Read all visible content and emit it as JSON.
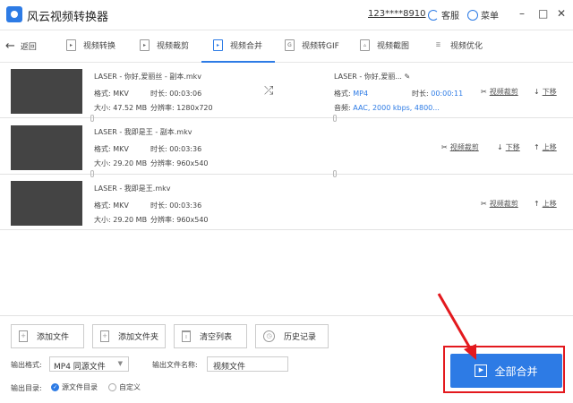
{
  "app": {
    "title": "风云视频转换器",
    "account": "123****8910",
    "service": "客服",
    "menu": "菜单"
  },
  "nav": {
    "back": "返回",
    "tabs": [
      "视频转换",
      "视频裁剪",
      "视频合并",
      "视频转GIF",
      "视频截图",
      "视频优化"
    ],
    "active": 2
  },
  "files": [
    {
      "name": "LASER - 你好,爱丽丝 - 副本.mkv",
      "format": "格式: MKV",
      "duration": "时长: 00:03:06",
      "size": "大小: 47.52 MB",
      "resolution": "分辨率: 1280x720",
      "actions": [
        "视频裁剪",
        "下移"
      ]
    },
    {
      "name": "LASER - 我即是王 - 副本.mkv",
      "format": "格式: MKV",
      "duration": "时长: 00:03:36",
      "size": "大小: 29.20 MB",
      "resolution": "分辨率: 960x540",
      "actions": [
        "视频裁剪",
        "下移",
        "上移"
      ]
    },
    {
      "name": "LASER - 我即是王.mkv",
      "format": "格式: MKV",
      "duration": "时长: 00:03:36",
      "size": "大小: 29.20 MB",
      "resolution": "分辨率: 960x540",
      "actions": [
        "视频裁剪",
        "上移"
      ]
    }
  ],
  "output_info": {
    "name": "LASER - 你好,爱丽...",
    "format_label": "格式:",
    "format": "MP4",
    "duration_label": "时长:",
    "duration": "00:00:11",
    "audio_label": "音频:",
    "audio": "AAC, 2000 kbps, 4800..."
  },
  "buttons": {
    "add_file": "添加文件",
    "add_folder": "添加文件夹",
    "clear": "清空列表",
    "history": "历史记录",
    "merge_all": "全部合并"
  },
  "settings": {
    "format_label": "输出格式:",
    "format_value": "MP4 同源文件",
    "filename_label": "输出文件名称:",
    "filename_value": "视频文件",
    "dir_label": "输出目录:",
    "dir_source": "源文件目录",
    "dir_custom": "自定义"
  },
  "colors": {
    "accent": "#2d7be5",
    "highlight": "#e3191e"
  }
}
